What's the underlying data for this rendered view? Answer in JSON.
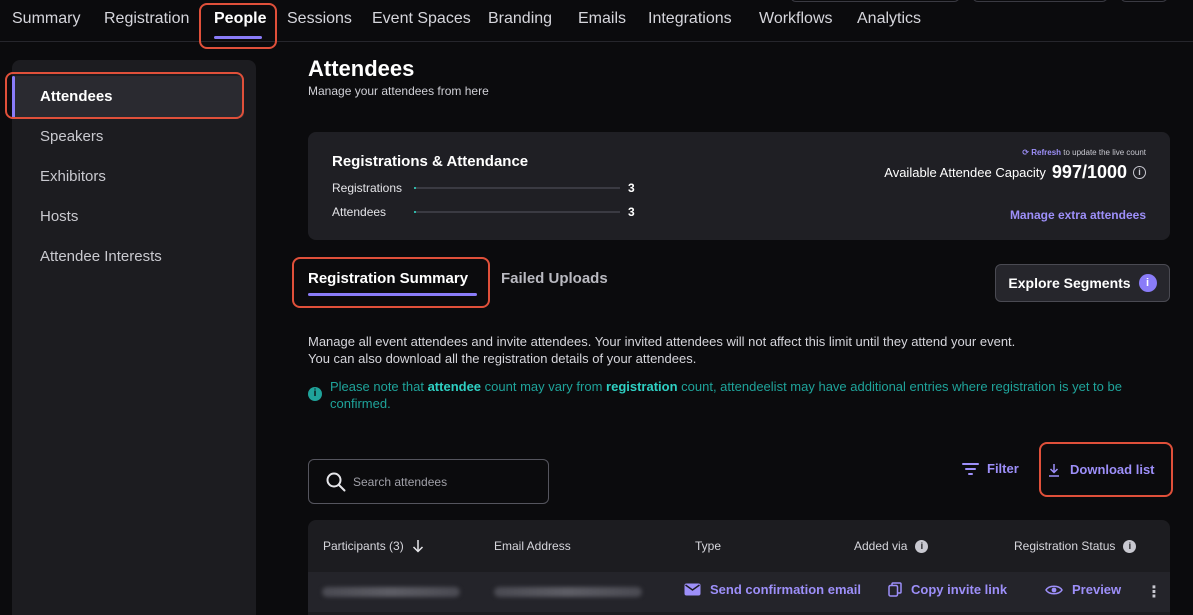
{
  "topnav": {
    "tabs": [
      "Summary",
      "Registration",
      "People",
      "Sessions",
      "Event Spaces",
      "Branding",
      "Emails",
      "Integrations",
      "Workflows",
      "Analytics"
    ],
    "active_tab": "People"
  },
  "sidebar": {
    "items": [
      "Attendees",
      "Speakers",
      "Exhibitors",
      "Hosts",
      "Attendee Interests"
    ],
    "active_item": "Attendees"
  },
  "page": {
    "title": "Attendees",
    "subtitle": "Manage your attendees from here"
  },
  "stats": {
    "title": "Registrations & Attendance",
    "rows": [
      {
        "label": "Registrations",
        "value": "3"
      },
      {
        "label": "Attendees",
        "value": "3"
      }
    ],
    "refresh_link": "Refresh",
    "refresh_suffix": "to update the live count",
    "capacity_label": "Available Attendee Capacity",
    "capacity_value": "997/1000",
    "manage_extra": "Manage extra attendees"
  },
  "subtabs": {
    "items": [
      "Registration Summary",
      "Failed Uploads"
    ],
    "active": "Registration Summary",
    "explore_button": "Explore Segments"
  },
  "description": {
    "line1": "Manage all event attendees and invite attendees. Your invited attendees will not affect this limit until they attend your event.",
    "line2": "You can also download all the registration details of your attendees.",
    "note_pre": "Please note that ",
    "note_term1": "attendee",
    "note_mid": " count may vary from ",
    "note_term2": "registration",
    "note_post": " count, attendeelist may have additional entries where registration is yet to be confirmed."
  },
  "toolbar": {
    "search_placeholder": "Search attendees",
    "filter_label": "Filter",
    "download_label": "Download list"
  },
  "table": {
    "columns": [
      "Participants (3)",
      "Email Address",
      "Type",
      "Added via",
      "Registration Status"
    ],
    "row_actions": [
      "Send confirmation email",
      "Copy invite link",
      "Preview"
    ]
  },
  "colors": {
    "accent": "#8a7cf8",
    "teal_note": "#1fa39a",
    "highlight": "#e0503a"
  }
}
